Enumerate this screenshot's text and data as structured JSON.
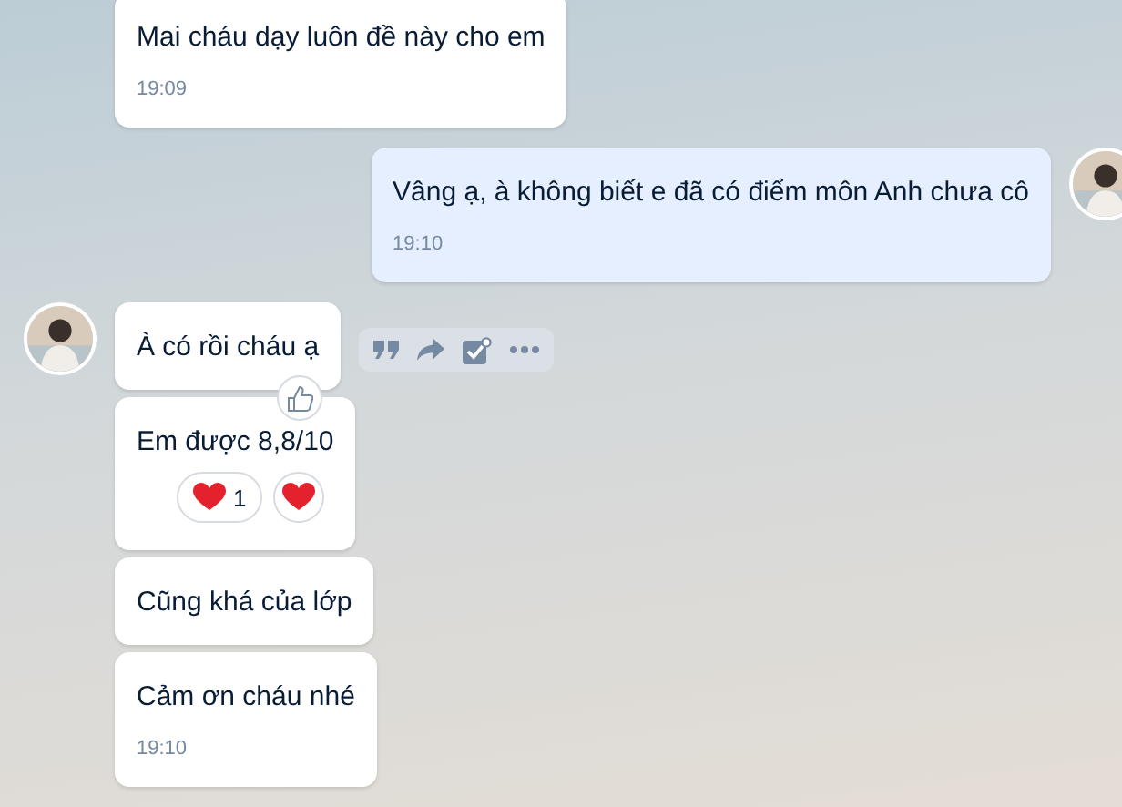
{
  "messages": [
    {
      "kind": "received",
      "text": "Mai cháu dạy luôn đề này cho em",
      "time": "19:09",
      "avatar": false
    },
    {
      "kind": "sent",
      "text": "Vâng ạ, à không biết e đã có điểm môn Anh chưa cô",
      "time": "19:10",
      "avatar": true
    },
    {
      "kind": "received",
      "text": "À có rồi cháu ạ",
      "avatar": true,
      "like_button": true,
      "toolbar": [
        {
          "kind": "quote"
        },
        {
          "kind": "forward"
        },
        {
          "kind": "task"
        },
        {
          "kind": "more"
        }
      ]
    },
    {
      "kind": "received",
      "text": "Em được 8,8/10",
      "avatar": false,
      "reactions": [
        {
          "count": "1"
        }
      ],
      "react_button": true
    },
    {
      "kind": "received",
      "text": "Cũng khá của lớp",
      "avatar": false
    },
    {
      "kind": "received",
      "text": "Cảm ơn cháu nhé",
      "time": "19:10",
      "avatar": false
    }
  ]
}
